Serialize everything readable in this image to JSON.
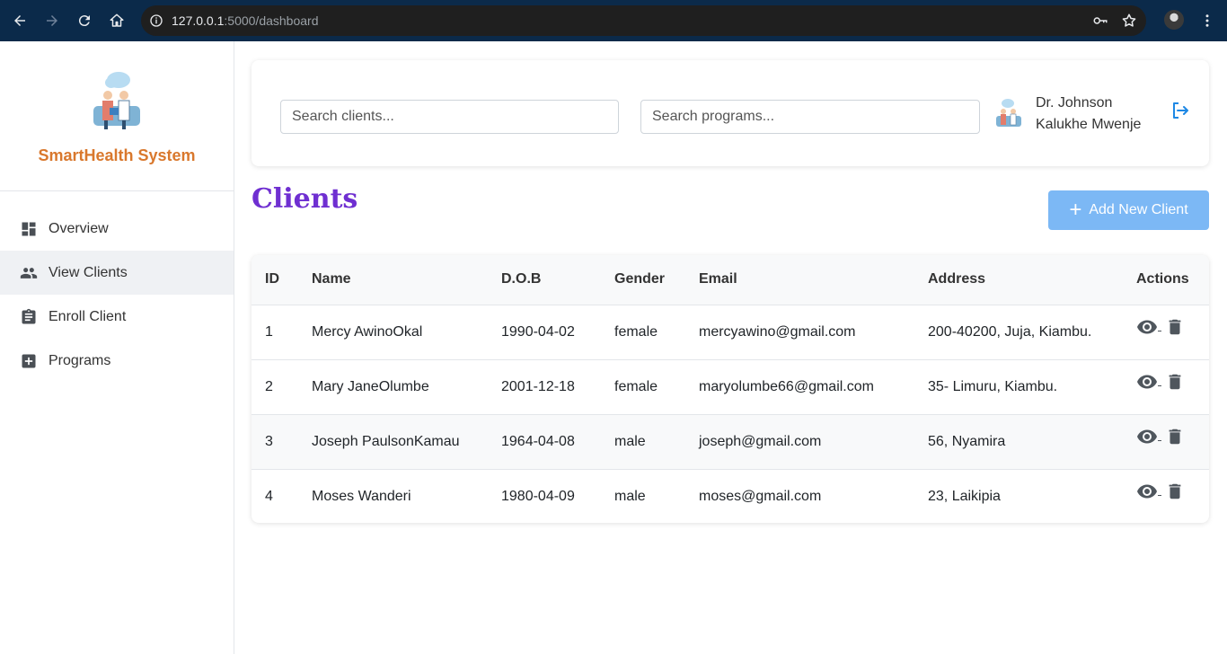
{
  "browser": {
    "url_host": "127.0.0.1",
    "url_rest": ":5000/dashboard"
  },
  "sidebar": {
    "brand": "SmartHealth System",
    "items": [
      {
        "label": "Overview",
        "icon": "dashboard-icon"
      },
      {
        "label": "View Clients",
        "icon": "people-icon",
        "active": true
      },
      {
        "label": "Enroll Client",
        "icon": "clipboard-icon"
      },
      {
        "label": "Programs",
        "icon": "medical-plus-icon"
      }
    ]
  },
  "topbar": {
    "search_clients_placeholder": "Search clients...",
    "search_programs_placeholder": "Search programs...",
    "doctor_name_line1": "Dr. Johnson",
    "doctor_name_line2": "Kalukhe Mwenje"
  },
  "main": {
    "title": "Clients",
    "add_button_label": "Add New Client",
    "table": {
      "headers": [
        "ID",
        "Name",
        "D.O.B",
        "Gender",
        "Email",
        "Address",
        "Actions"
      ],
      "rows": [
        {
          "id": "1",
          "name": "Mercy AwinoOkal",
          "dob": "1990-04-02",
          "gender": "female",
          "email": "mercyawino@gmail.com",
          "address": "200-40200, Juja, Kiambu."
        },
        {
          "id": "2",
          "name": "Mary JaneOlumbe",
          "dob": "2001-12-18",
          "gender": "female",
          "email": "maryolumbe66@gmail.com",
          "address": "35- Limuru, Kiambu."
        },
        {
          "id": "3",
          "name": "Joseph PaulsonKamau",
          "dob": "1964-04-08",
          "gender": "male",
          "email": "joseph@gmail.com",
          "address": "56, Nyamira"
        },
        {
          "id": "4",
          "name": "Moses Wanderi",
          "dob": "1980-04-09",
          "gender": "male",
          "email": "moses@gmail.com",
          "address": "23, Laikipia"
        }
      ]
    }
  },
  "colors": {
    "brand": "#d9782d",
    "title": "#6f2fd1",
    "add_button": "#7cb8f5",
    "logout": "#1e88e5",
    "browser_bar": "#0b2a4a"
  }
}
